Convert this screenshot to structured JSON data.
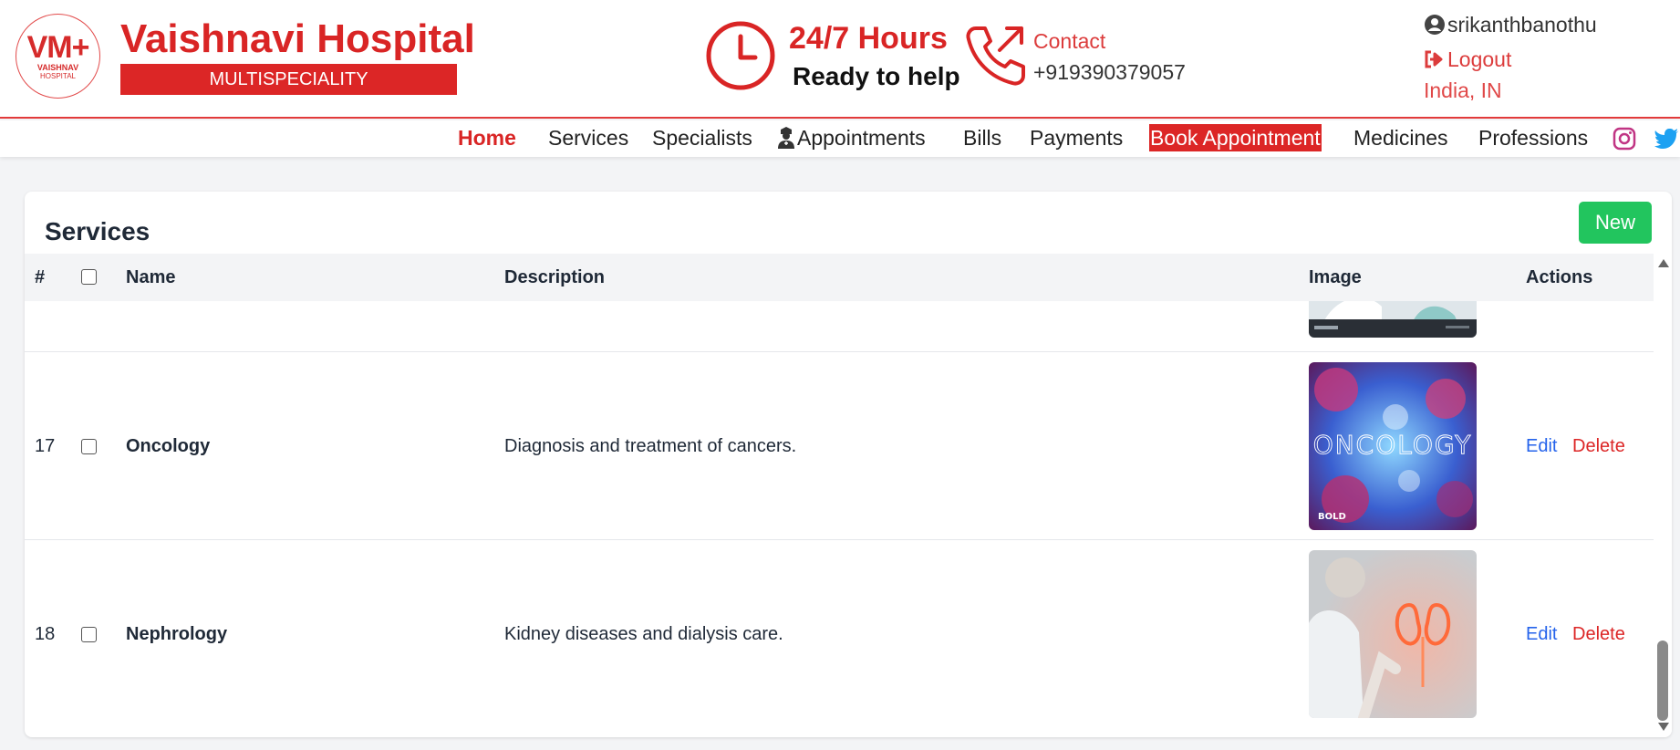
{
  "brand": {
    "logo_mark": "VM+",
    "logo_line1": "VAISHNAV",
    "logo_line2": "HOSPITAL",
    "name": "Vaishnavi Hospital",
    "tagline": "MULTISPECIALITY"
  },
  "header": {
    "hours": "24/7 Hours",
    "ready": "Ready to help",
    "contact_label": "Contact",
    "phone": "+919390379057",
    "username": "srikanthbanothu",
    "logout": "Logout",
    "locale": "India, IN"
  },
  "nav": {
    "items": [
      {
        "label": "Home"
      },
      {
        "label": "Services"
      },
      {
        "label": "Specialists"
      },
      {
        "label": "Appointments"
      },
      {
        "label": "Bills"
      },
      {
        "label": "Payments"
      },
      {
        "label": "Book Appointment"
      },
      {
        "label": "Medicines"
      },
      {
        "label": "Professions"
      }
    ],
    "social": [
      "instagram-icon",
      "twitter-icon"
    ]
  },
  "page": {
    "title": "Services",
    "new_button": "New"
  },
  "table": {
    "columns": [
      "#",
      "Name",
      "Description",
      "Image",
      "Actions"
    ],
    "rows": [
      {
        "id": "17",
        "name": "Oncology",
        "description": "Diagnosis and treatment of cancers.",
        "image_text": "ONCOLOGY",
        "edit": "Edit",
        "delete": "Delete"
      },
      {
        "id": "18",
        "name": "Nephrology",
        "description": "Kidney diseases and dialysis care.",
        "edit": "Edit",
        "delete": "Delete"
      }
    ]
  },
  "colors": {
    "brand_red": "#dc2626",
    "new_green": "#22c55e",
    "edit_blue": "#2563eb"
  }
}
